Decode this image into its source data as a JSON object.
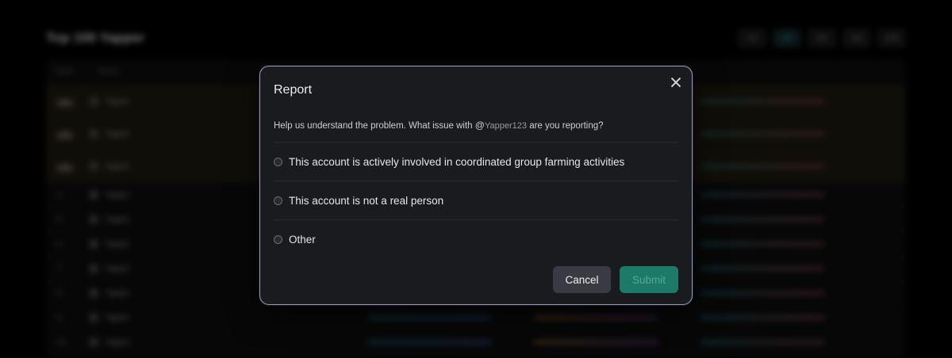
{
  "background": {
    "title": "Top 100 Yapper",
    "filters": [
      {
        "label": "7D",
        "active": false
      },
      {
        "label": "30D",
        "active": true
      },
      {
        "label": "3M",
        "active": false
      },
      {
        "label": "6M",
        "active": false
      },
      {
        "label": "12M",
        "active": false
      }
    ],
    "table_headers": [
      "Rank",
      "Name"
    ],
    "rows": [
      {
        "rank": "",
        "name": "Yapper",
        "top": true
      },
      {
        "rank": "",
        "name": "Yapper",
        "top": true
      },
      {
        "rank": "",
        "name": "Yapper",
        "top": true
      },
      {
        "rank": "4",
        "name": "Yapper",
        "top": false
      },
      {
        "rank": "5",
        "name": "Yapper",
        "top": false
      },
      {
        "rank": "6",
        "name": "Yapper",
        "top": false
      },
      {
        "rank": "7",
        "name": "Yapper",
        "top": false
      },
      {
        "rank": "8",
        "name": "Yapper",
        "top": false
      },
      {
        "rank": "9",
        "name": "Yapper",
        "top": false
      },
      {
        "rank": "10",
        "name": "Yapper",
        "top": false
      }
    ]
  },
  "modal": {
    "title": "Report",
    "description_prefix": "Help us understand the problem. What issue with",
    "at_symbol": "@",
    "username": "Yapper123",
    "description_suffix": "are you reporting?",
    "options": [
      {
        "label": "This account is actively involved in coordinated group farming activities",
        "selected": false
      },
      {
        "label": "This account is not a real person",
        "selected": false
      },
      {
        "label": "Other",
        "selected": false
      }
    ],
    "cancel_label": "Cancel",
    "submit_label": "Submit",
    "submit_disabled": true
  },
  "colors": {
    "modal_bg": "#1a1b1f",
    "modal_border": "#9a95b4",
    "submit_bg": "#1d7a68",
    "cancel_bg": "#3a3b42"
  }
}
